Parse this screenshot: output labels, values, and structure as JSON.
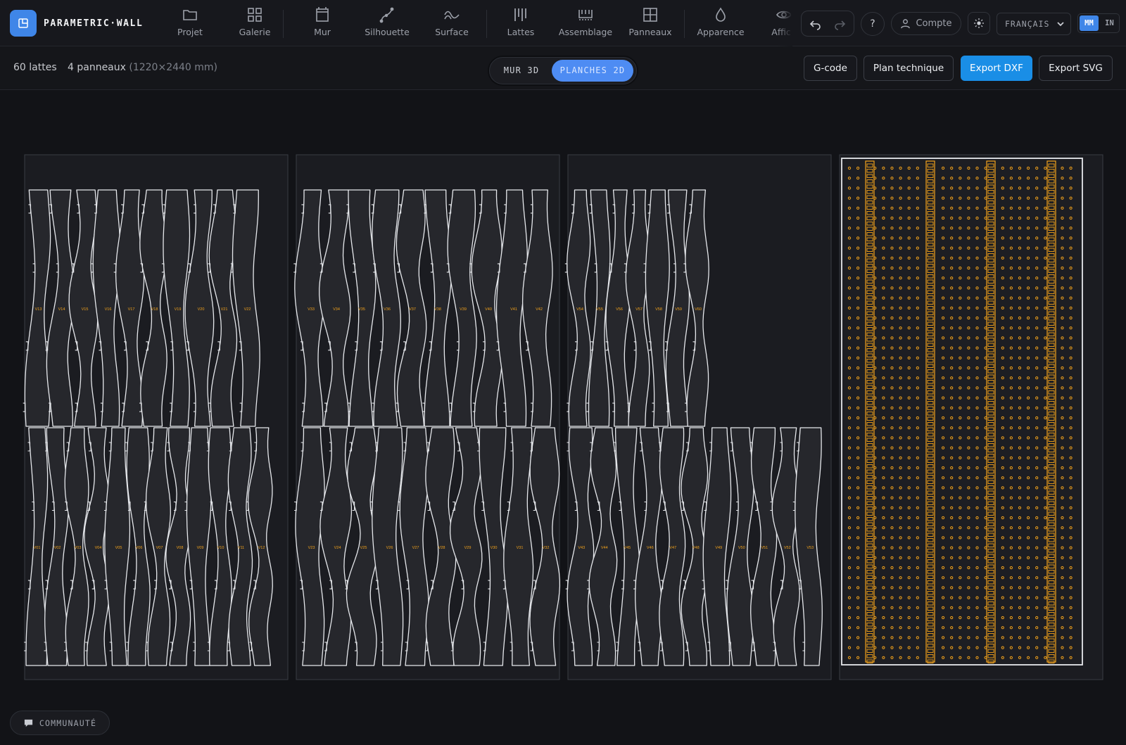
{
  "app": {
    "name": "PARAMETRIC·WALL"
  },
  "nav": [
    {
      "label": "Projet",
      "icon": "folder-icon"
    },
    {
      "label": "Galerie",
      "icon": "grid-icon"
    },
    {
      "label": "Mur",
      "icon": "wall-icon"
    },
    {
      "label": "Silhouette",
      "icon": "curve-icon"
    },
    {
      "label": "Surface",
      "icon": "wave-icon"
    },
    {
      "label": "Lattes",
      "icon": "slats-icon"
    },
    {
      "label": "Assemblage",
      "icon": "assembly-icon"
    },
    {
      "label": "Panneaux",
      "icon": "panels-icon"
    },
    {
      "label": "Apparence",
      "icon": "drop-icon"
    },
    {
      "label": "Affich",
      "icon": "eye-icon"
    }
  ],
  "header": {
    "help_label": "?",
    "account_label": "Compte",
    "language": "FRANÇAIS",
    "units": [
      "MM",
      "IN"
    ],
    "active_unit": "MM"
  },
  "summary": {
    "slats": "60 lattes",
    "panels": "4 panneaux",
    "panel_size": "(1220×2440 mm)"
  },
  "view_toggle": {
    "options": [
      "MUR 3D",
      "PLANCHES 2D"
    ],
    "active": "PLANCHES 2D"
  },
  "actions": {
    "gcode": "G-code",
    "tech_plan": "Plan technique",
    "export_dxf": "Export DXF",
    "export_svg": "Export SVG"
  },
  "sheets": [
    {
      "top_labels": [
        "V13",
        "V14",
        "V15",
        "V16",
        "V17",
        "V18",
        "V19",
        "V20",
        "V21",
        "V22"
      ],
      "bottom_labels": [
        "V01",
        "V02",
        "V03",
        "V04",
        "V05",
        "V06",
        "V07",
        "V08",
        "V09",
        "V10",
        "V11",
        "V12"
      ]
    },
    {
      "top_labels": [
        "V33",
        "V34",
        "V35",
        "V36",
        "V37",
        "V38",
        "V39",
        "V40",
        "V41",
        "V42"
      ],
      "bottom_labels": [
        "V23",
        "V24",
        "V25",
        "V26",
        "V27",
        "V28",
        "V29",
        "V30",
        "V31",
        "V32"
      ]
    },
    {
      "top_labels": [
        "V54",
        "V55",
        "V56",
        "V57",
        "V58",
        "V59",
        "V60"
      ],
      "bottom_labels": [
        "V43",
        "V44",
        "V45",
        "V46",
        "V47",
        "V48",
        "V49",
        "V50",
        "V51",
        "V52",
        "V53"
      ]
    }
  ],
  "colors": {
    "accent": "#3f86e8",
    "primary_button": "#1a8ee6",
    "stroke": "#e6e8ec",
    "hole": "#f2a21b",
    "sheet_fill": "#1b1c21",
    "slat_fill": "#26272c"
  },
  "community_label": "COMMUNAUTÉ"
}
